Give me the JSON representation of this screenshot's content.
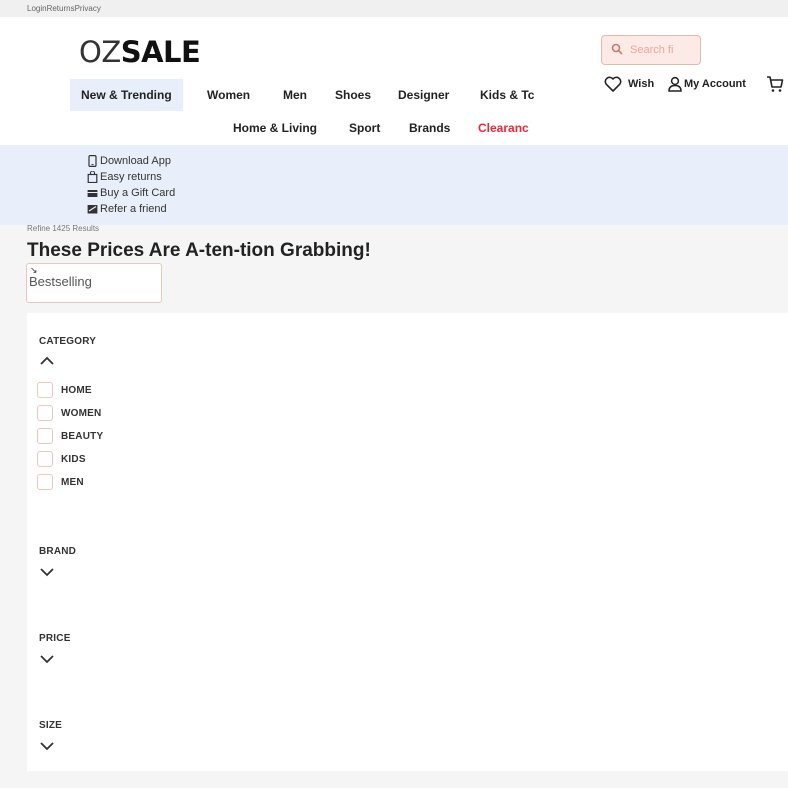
{
  "utility": {
    "links": "LoginReturnsPrivacy"
  },
  "logo": {
    "part1": "OZ",
    "part2": "SALE"
  },
  "search": {
    "placeholder": "Search fi"
  },
  "account": {
    "wish": "Wish",
    "my_account": "My Account"
  },
  "nav": {
    "row1": [
      "New & Trending",
      "Women",
      "Men",
      "Shoes",
      "Designer",
      "Kids & Tc"
    ],
    "row2": [
      "Home & Living",
      "Sport",
      "Brands",
      "Clearanc"
    ]
  },
  "promo": [
    "Download App",
    "Easy returns",
    "Buy a Gift Card",
    "Refer a friend"
  ],
  "breadcrumb": "Refine 1425 Results",
  "page_title": "These Prices Are A-ten-tion Grabbing!",
  "sort": {
    "value": "Bestselling"
  },
  "filters": {
    "category": {
      "title": "CATEGORY",
      "options": [
        "HOME",
        "WOMEN",
        "BEAUTY",
        "KIDS",
        "MEN"
      ]
    },
    "brand": {
      "title": "BRAND"
    },
    "price": {
      "title": "PRICE"
    },
    "size": {
      "title": "SIZE"
    }
  },
  "colors": {
    "accent_red": "#e8283a",
    "promo_bg": "#e8effb",
    "search_bg": "#fbeae6"
  }
}
